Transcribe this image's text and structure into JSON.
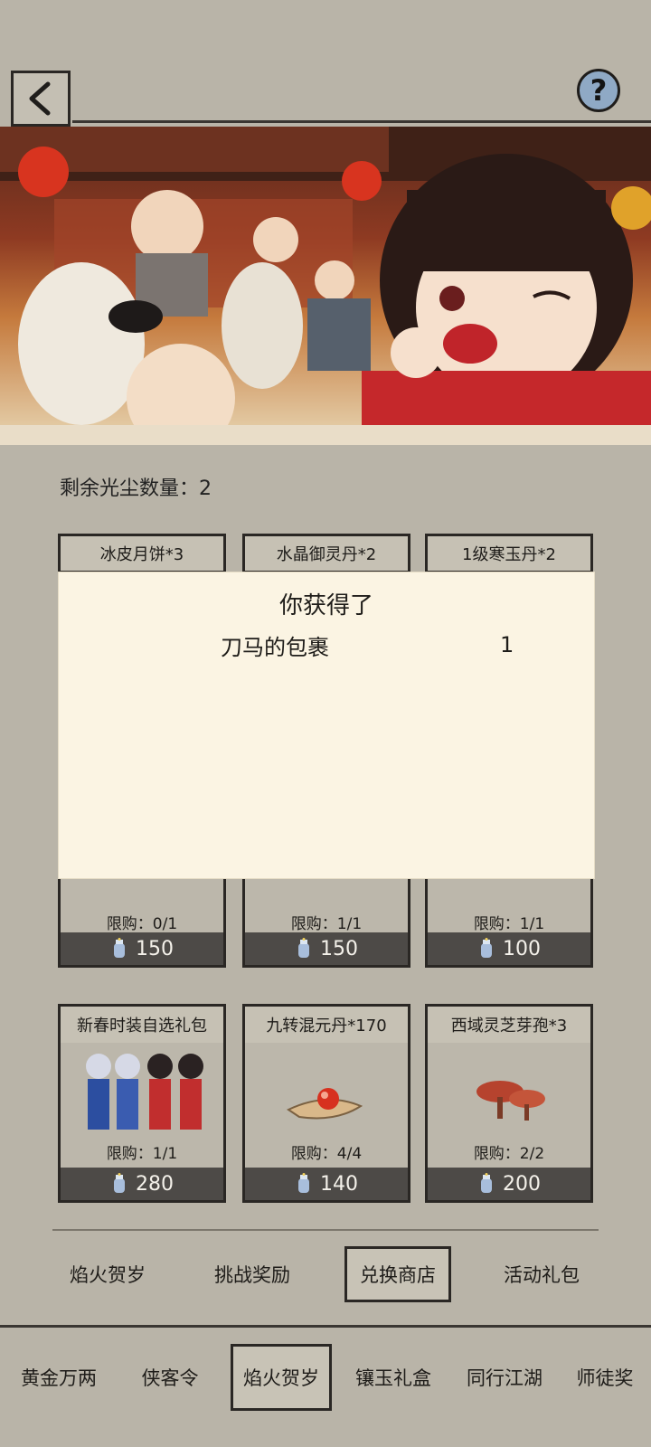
{
  "header": {
    "back_icon": "back-chevron-icon",
    "help_icon": "question-mark-icon",
    "help_label": "?"
  },
  "dust": {
    "label": "剩余光尘数量：2"
  },
  "cards_row1": [
    {
      "title": "冰皮月饼*3",
      "limit": "限购：0/1",
      "price": "150"
    },
    {
      "title": "水晶御灵丹*2",
      "limit": "限购：1/1",
      "price": "150"
    },
    {
      "title": "1级寒玉丹*2",
      "limit": "限购：1/1",
      "price": "100"
    }
  ],
  "cards_row2": [
    {
      "title": "新春时装自选礼包",
      "limit": "限购：1/1",
      "price": "280"
    },
    {
      "title": "九转混元丹*170",
      "limit": "限购：4/4",
      "price": "140"
    },
    {
      "title": "西域灵芝芽孢*3",
      "limit": "限购：2/2",
      "price": "200"
    }
  ],
  "modal": {
    "title": "你获得了",
    "item_name": "刀马的包裹",
    "item_qty": "1"
  },
  "subtabs": [
    "焰火贺岁",
    "挑战奖励",
    "兑换商店",
    "活动礼包"
  ],
  "subtab_active": "兑换商店",
  "navtabs": [
    "黄金万两",
    "侠客令",
    "焰火贺岁",
    "镶玉礼盒",
    "同行江湖",
    "师徒奖"
  ],
  "navtab_active": "焰火贺岁",
  "colors": {
    "background": "#b9b4a8",
    "price_bar": "#4d4a47",
    "modal_bg": "#fbf4e3",
    "help_btn": "#8fa9c5"
  }
}
